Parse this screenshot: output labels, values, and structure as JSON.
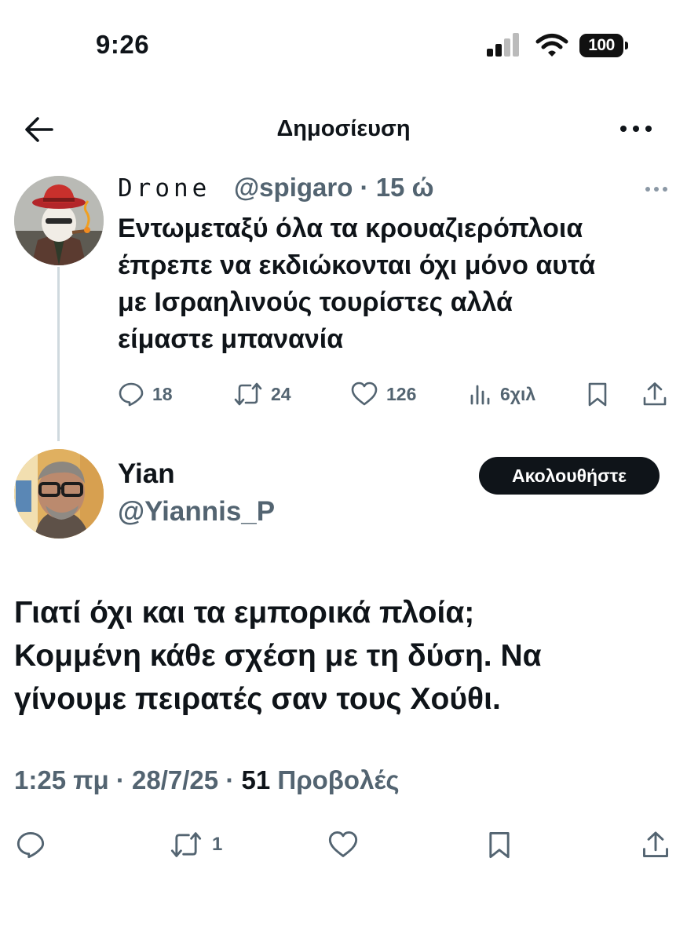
{
  "status_bar": {
    "time": "9:26",
    "battery": "100",
    "icons": [
      "signal-icon",
      "wifi-icon",
      "battery-icon"
    ]
  },
  "header": {
    "title": "Δημοσίευση",
    "back_icon": "arrow-left-icon",
    "more_icon": "more-horizontal-icon"
  },
  "parent_post": {
    "display_name": "Drone",
    "handle": "@spigaro",
    "time": "· 15 ώ",
    "text": "Εντωμεταξύ όλα τα κρουαζιερόπλοια\nέπρεπε να εκδιώκονται όχι μόνο αυτά\nμε Ισραηλινούς τουρίστες αλλά\nείμαστε μπανανία",
    "actions": {
      "replies": "18",
      "reposts": "24",
      "likes": "126",
      "views": "6χιλ"
    }
  },
  "main_post": {
    "display_name": "Yian",
    "handle": "@Yiannis_P",
    "follow_label": "Ακολουθήστε",
    "text": "Γιατί όχι και τα εμπορικά πλοία;\nΚομμένη κάθε σχέση με τη δύση. Να\nγίνουμε πειρατές σαν τους Χούθι.",
    "time": "1:25 πμ",
    "date": "28/7/25",
    "separator": "·",
    "views_count": "51",
    "views_label": "Προβολές",
    "actions": {
      "reposts": "1"
    }
  },
  "colors": {
    "text": "#0f1419",
    "secondary": "#536471",
    "thread_line": "#cfd9de",
    "button_bg": "#0f1419"
  }
}
